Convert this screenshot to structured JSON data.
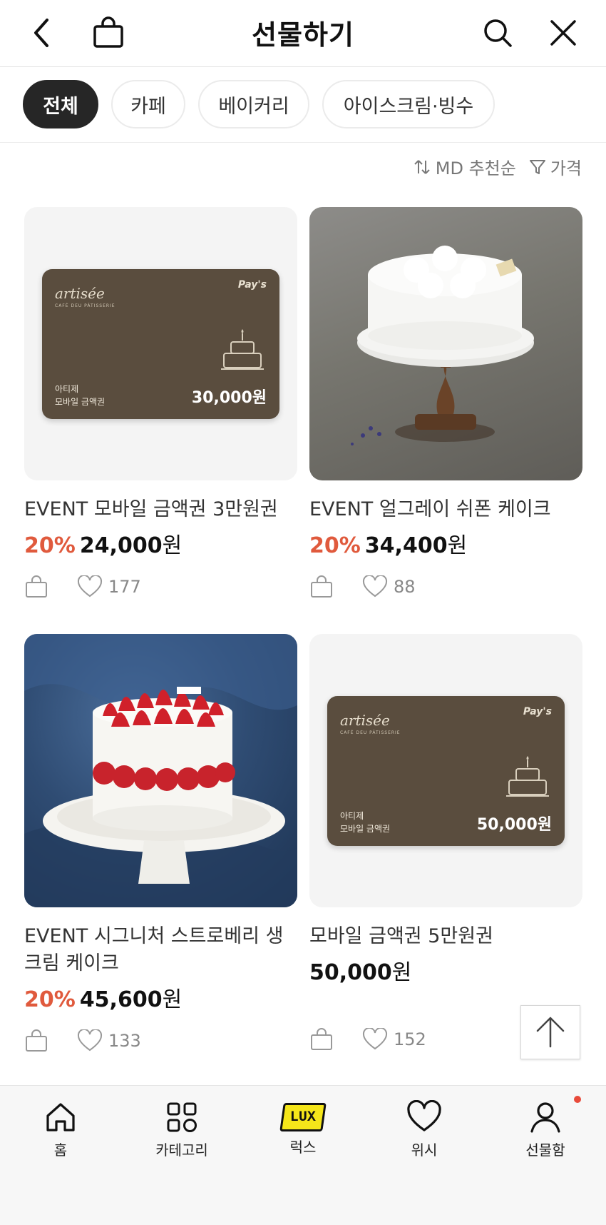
{
  "header": {
    "title": "선물하기"
  },
  "chips": [
    {
      "label": "전체",
      "active": true
    },
    {
      "label": "카페",
      "active": false
    },
    {
      "label": "베이커리",
      "active": false
    },
    {
      "label": "아이스크림·빙수",
      "active": false
    }
  ],
  "sort": {
    "order_label": "MD 추천순",
    "filter_label": "가격"
  },
  "products": [
    {
      "name": "EVENT 모바일 금액권 3만원권",
      "discount": "20%",
      "price": "24,000",
      "currency": "원",
      "likes": "177",
      "card": {
        "brand": "artisée",
        "brand_sub": "CAFÉ DEU PÂTISSERIE",
        "pays": "Pay's",
        "line1": "아티제",
        "line2": "모바일 금액권",
        "amount": "30,000원"
      }
    },
    {
      "name": "EVENT 얼그레이 쉬폰 케이크",
      "discount": "20%",
      "price": "34,400",
      "currency": "원",
      "likes": "88"
    },
    {
      "name_line1": "EVENT 시그니처 스트로베리 생",
      "name_line2": "크림 케이크",
      "discount": "20%",
      "price": "45,600",
      "currency": "원",
      "likes": "133"
    },
    {
      "name": "모바일 금액권 5만원권",
      "price": "50,000",
      "currency": "원",
      "likes": "152",
      "card": {
        "brand": "artisée",
        "brand_sub": "CAFÉ DEU PÂTISSERIE",
        "pays": "Pay's",
        "line1": "아티제",
        "line2": "모바일 금액권",
        "amount": "50,000원"
      }
    }
  ],
  "bottom_nav": [
    {
      "label": "홈",
      "icon": "home-icon"
    },
    {
      "label": "카테고리",
      "icon": "grid-icon"
    },
    {
      "label": "럭스",
      "icon": "lux-icon",
      "badge_text": "LUX"
    },
    {
      "label": "위시",
      "icon": "heart-icon"
    },
    {
      "label": "선물함",
      "icon": "person-icon",
      "has_dot": true
    }
  ],
  "colors": {
    "accent_discount": "#e05a3d",
    "chip_active_bg": "#262626",
    "giftcard_bg": "#5a4d3e",
    "lux_yellow": "#f5e61a",
    "notify_dot": "#e84a3a"
  }
}
